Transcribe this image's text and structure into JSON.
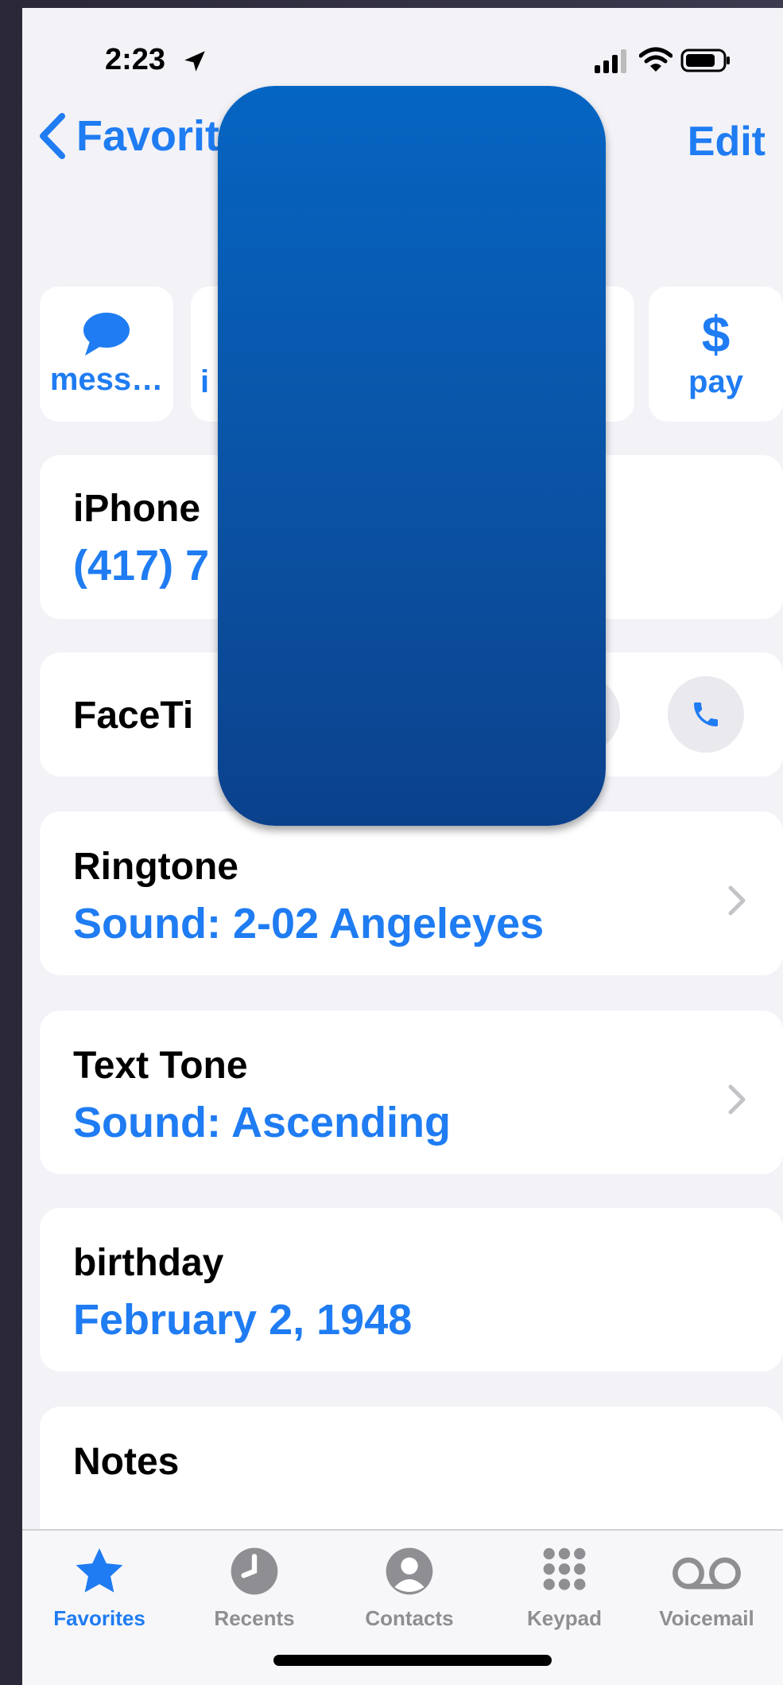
{
  "status": {
    "time": "2:23"
  },
  "nav": {
    "back_label": "Favorit",
    "edit_label": "Edit"
  },
  "actions": [
    {
      "label": "mess…",
      "icon": "message-icon"
    },
    {
      "label": "i",
      "icon": "call-icon"
    },
    {
      "label": "pay",
      "icon": "dollar-icon"
    }
  ],
  "phone_card": {
    "title": "iPhone",
    "value": "(417) 7"
  },
  "facetime": {
    "title": "FaceTi"
  },
  "ringtone": {
    "title": "Ringtone",
    "value": "Sound: 2-02 Angeleyes"
  },
  "texttone": {
    "title": "Text Tone",
    "value": "Sound: Ascending"
  },
  "birthday": {
    "title": "birthday",
    "value": "February 2, 1948"
  },
  "notes": {
    "title": "Notes"
  },
  "tabs": [
    {
      "label": "Favorites",
      "icon": "star-icon",
      "active": true
    },
    {
      "label": "Recents",
      "icon": "clock-icon",
      "active": false
    },
    {
      "label": "Contacts",
      "icon": "person-icon",
      "active": false
    },
    {
      "label": "Keypad",
      "icon": "keypad-icon",
      "active": false
    },
    {
      "label": "Voicemail",
      "icon": "voicemail-icon",
      "active": false
    }
  ],
  "colors": {
    "accent": "#1f7cf2",
    "background": "#f2f2f7",
    "redaction": "#0b4f9f"
  }
}
